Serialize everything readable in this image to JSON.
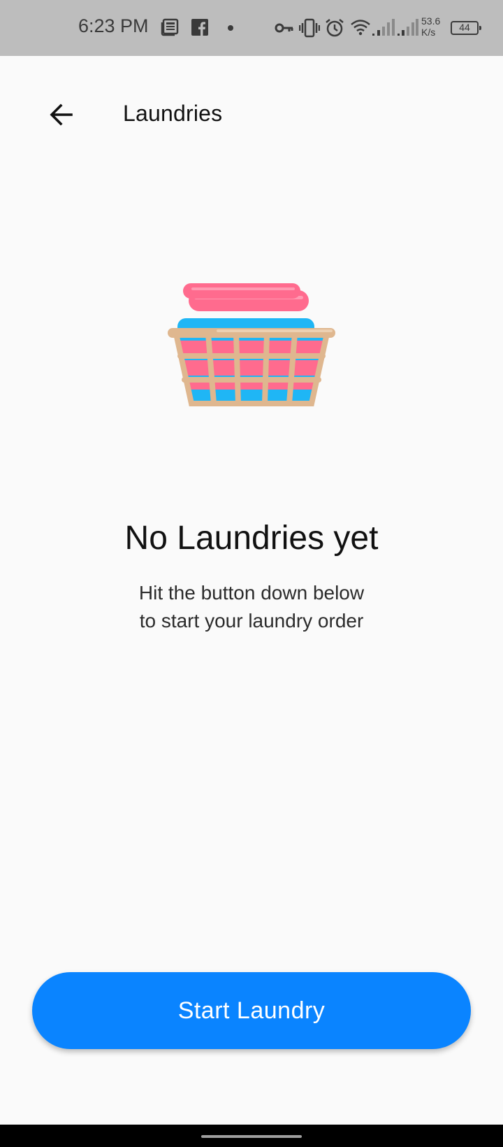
{
  "status_bar": {
    "time": "6:23 PM",
    "net_speed_value": "53.6",
    "net_speed_unit": "K/s",
    "battery": "44",
    "icons": [
      "news-icon",
      "facebook-icon",
      "dot-icon",
      "vpn-key-icon",
      "vibrate-icon",
      "alarm-icon",
      "wifi-icon",
      "signal-icon",
      "signal-icon",
      "battery-icon"
    ]
  },
  "app_bar": {
    "title": "Laundries",
    "back_icon": "arrow-left-icon"
  },
  "empty_state": {
    "illustration": "laundry-basket-icon",
    "title": "No Laundries yet",
    "subtitle_line1": "Hit the button down below",
    "subtitle_line2": "to start your laundry order"
  },
  "actions": {
    "start_label": "Start Laundry"
  },
  "colors": {
    "accent": "#0a84ff",
    "background": "#fafafa",
    "status_bar": "#bdbdbd",
    "towel_pink": "#ff6b8e",
    "towel_blue": "#1fb6f5",
    "basket_tan": "#dfb78f"
  }
}
